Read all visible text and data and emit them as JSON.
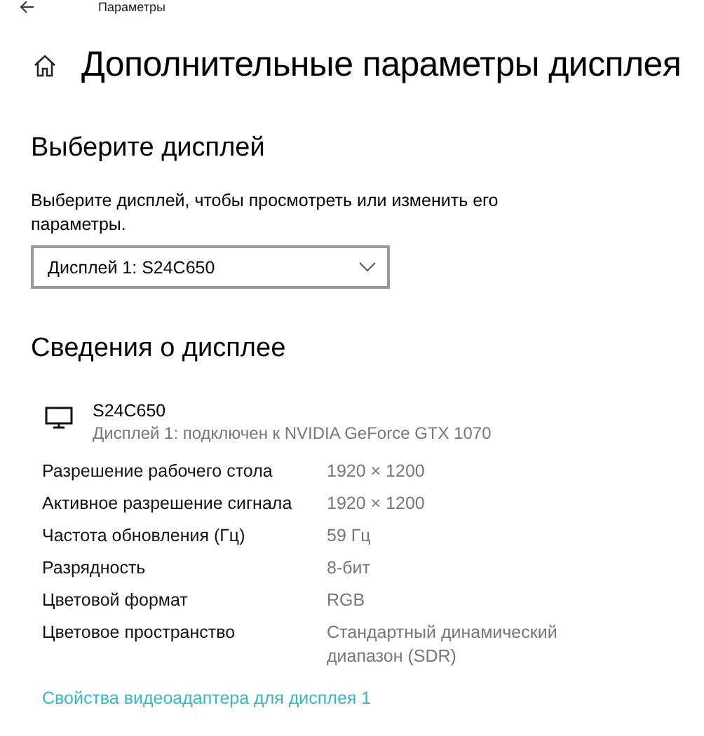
{
  "window": {
    "title": "Параметры"
  },
  "page": {
    "title": "Дополнительные параметры дисплея"
  },
  "select_display": {
    "heading": "Выберите дисплей",
    "description": "Выберите дисплей, чтобы просмотреть или изменить его параметры.",
    "dropdown": {
      "value": "Дисплей 1: S24C650"
    }
  },
  "display_info": {
    "heading": "Сведения о дисплее",
    "monitor": {
      "name": "S24C650",
      "subtitle": "Дисплей 1: подключен к NVIDIA GeForce GTX 1070"
    },
    "rows": [
      {
        "label": "Разрешение рабочего стола",
        "value": "1920 × 1200"
      },
      {
        "label": "Активное разрешение сигнала",
        "value": "1920 × 1200"
      },
      {
        "label": "Частота обновления (Гц)",
        "value": "59 Гц"
      },
      {
        "label": "Разрядность",
        "value": "8-бит"
      },
      {
        "label": "Цветовой формат",
        "value": "RGB"
      },
      {
        "label": "Цветовое пространство",
        "value": "Стандартный динамический диапазон (SDR)"
      }
    ],
    "link": "Свойства видеоадаптера для дисплея 1"
  }
}
